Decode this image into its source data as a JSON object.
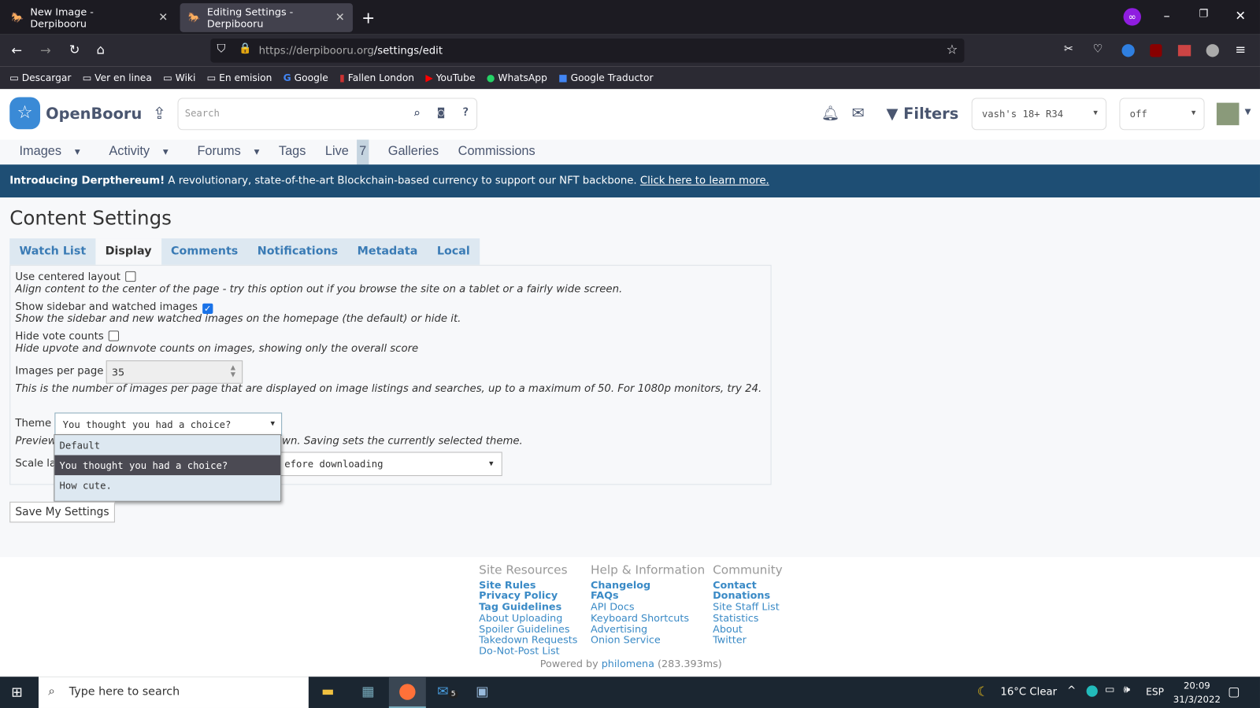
{
  "browser": {
    "tabs": [
      {
        "title": "New Image - Derpibooru"
      },
      {
        "title": "Editing Settings - Derpibooru"
      }
    ],
    "url_host": "https://derpibooru.org",
    "url_path": "/settings/edit",
    "bookmarks": [
      "Descargar",
      "Ver en linea",
      "Wiki",
      "En emision",
      "Google",
      "Fallen London",
      "YouTube",
      "WhatsApp",
      "Google Traductor"
    ]
  },
  "header": {
    "logo": "OpenBooru",
    "search_placeholder": "Search",
    "filters_label": "Filters",
    "filter_select": "vash's 18+ R34",
    "spoiler_select": "off"
  },
  "nav": {
    "items": [
      "Images",
      "Activity",
      "Forums",
      "Tags",
      "Live",
      "7",
      "Galleries",
      "Commissions"
    ]
  },
  "banner": {
    "bold": "Introducing Derpthereum!",
    "text": " A revolutionary, state-of-the-art Blockchain-based currency to support our NFT backbone. ",
    "link": "Click here to learn more."
  },
  "page": {
    "title": "Content Settings",
    "tabs": [
      "Watch List",
      "Display",
      "Comments",
      "Notifications",
      "Metadata",
      "Local"
    ],
    "active_tab": "Display",
    "settings": {
      "centered_label": "Use centered layout",
      "centered_checked": false,
      "centered_hint": "Align content to the center of the page - try this option out if you browse the site on a tablet or a fairly wide screen.",
      "sidebar_label": "Show sidebar and watched images",
      "sidebar_checked": true,
      "sidebar_hint": "Show the sidebar and new watched images on the homepage (the default) or hide it.",
      "votes_label": "Hide vote counts",
      "votes_checked": false,
      "votes_hint": "Hide upvote and downvote counts on images, showing only the overall score",
      "perpage_label": "Images per page",
      "perpage_value": "35",
      "perpage_hint": "This is the number of images per page that are displayed on image listings and searches, up to a maximum of 50. For 1080p monitors, try 24.",
      "theme_label": "Theme",
      "theme_value": "You thought you had a choice?",
      "theme_hint_a": "Preview",
      "theme_hint_b": "wn. Saving sets the currently selected theme.",
      "scale_label": "Scale la",
      "scale_value": "efore downloading",
      "theme_options": [
        "Default",
        "You thought you had a choice?",
        "How cute."
      ]
    },
    "save_label": "Save My Settings"
  },
  "footer": {
    "cols": [
      {
        "title": "Site Resources",
        "links": [
          "Site Rules",
          "Privacy Policy",
          "Tag Guidelines",
          "About Uploading",
          "Spoiler Guidelines",
          "Takedown Requests",
          "Do-Not-Post List"
        ]
      },
      {
        "title": "Help & Information",
        "links": [
          "Changelog",
          "FAQs",
          "API Docs",
          "Keyboard Shortcuts",
          "Advertising",
          "Onion Service"
        ]
      },
      {
        "title": "Community",
        "links": [
          "Contact",
          "Donations",
          "Site Staff List",
          "Statistics",
          "About",
          "Twitter"
        ]
      }
    ],
    "powered_a": "Powered by ",
    "powered_link": "philomena",
    "powered_b": " (283.393ms)"
  },
  "taskbar": {
    "search_placeholder": "Type here to search",
    "weather": "16°C  Clear",
    "lang": "ESP",
    "time": "20:09",
    "date": "31/3/2022",
    "mail_badge": "5"
  }
}
